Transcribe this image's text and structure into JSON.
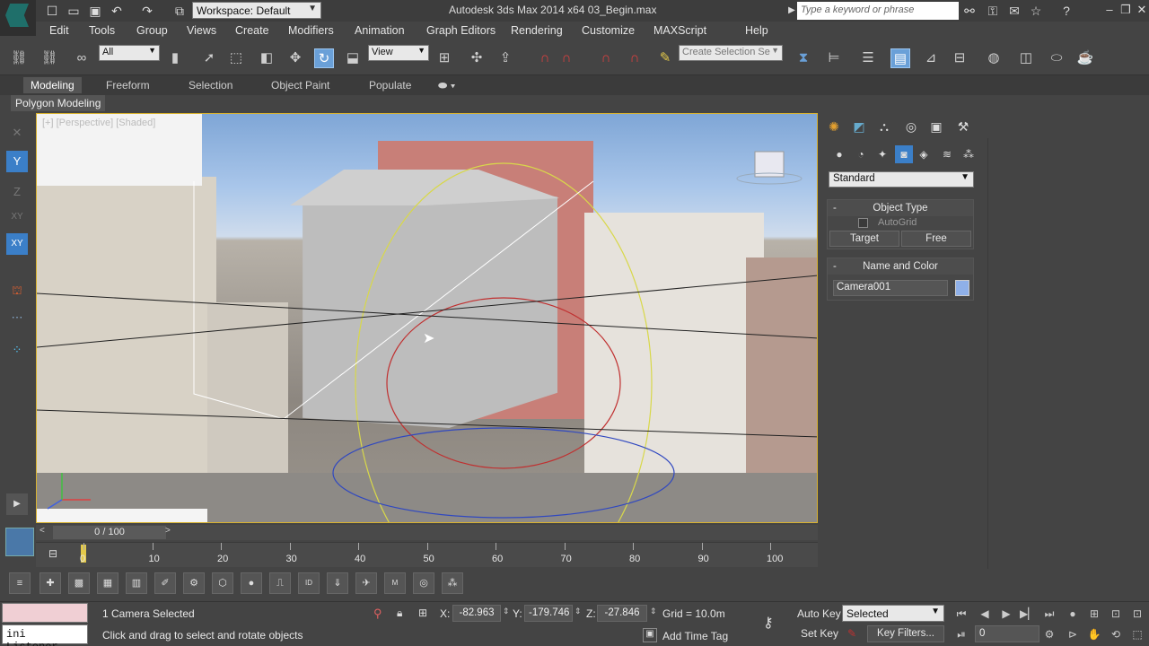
{
  "titlebar": {
    "workspace_label": "Workspace: Default",
    "title": "Autodesk 3ds Max  2014 x64      03_Begin.max",
    "search_placeholder": "Type a keyword or phrase"
  },
  "menu": [
    "Edit",
    "Tools",
    "Group",
    "Views",
    "Create",
    "Modifiers",
    "Animation",
    "Graph Editors",
    "Rendering",
    "Customize",
    "MAXScript",
    "Help"
  ],
  "toolbar": {
    "selection_filter": "All",
    "ref_coord": "View",
    "named_selection_placeholder": "Create Selection Se"
  },
  "ribbon": {
    "tabs": [
      "Modeling",
      "Freeform",
      "Selection",
      "Object Paint",
      "Populate"
    ],
    "active_tab": "Modeling",
    "panel_label": "Polygon Modeling"
  },
  "viewport": {
    "label": "[+] [Perspective] [Shaded]"
  },
  "command_panel": {
    "category": "Standard",
    "object_type_title": "Object Type",
    "autogrid_label": "AutoGrid",
    "buttons": [
      "Target",
      "Free"
    ],
    "name_color_title": "Name and Color",
    "object_name": "Camera001",
    "object_color": "#8fb0e8"
  },
  "timeline": {
    "frame_display": "0 / 100",
    "ticks": [
      "0",
      "10",
      "20",
      "30",
      "40",
      "50",
      "60",
      "70",
      "80",
      "90",
      "100"
    ],
    "current_frame": 0,
    "total_frames": 100
  },
  "status": {
    "listener": "ini Listener",
    "selection_count": "1 Camera Selected",
    "prompt": "Click and drag to select and rotate objects",
    "x_label": "X:",
    "x_value": "-82.963",
    "y_label": "Y:",
    "y_value": "-179.746",
    "z_label": "Z:",
    "z_value": "-27.846",
    "grid": "Grid = 10.0m",
    "add_time_tag": "Add Time Tag",
    "auto_key": "Auto Key",
    "set_key": "Set Key",
    "key_mode": "Selected",
    "key_filters": "Key Filters...",
    "frame_field": "0"
  },
  "colors": {
    "accent": "#3b7fc8",
    "viewport_border": "#d8b230",
    "logo": "#1f6f6a"
  }
}
